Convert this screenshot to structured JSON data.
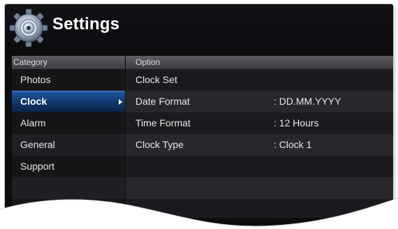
{
  "header": {
    "title": "Settings",
    "icon": "settings-gear-icon"
  },
  "category_pane": {
    "header": "Category",
    "items": [
      "Photos",
      "Clock",
      "Alarm",
      "General",
      "Support"
    ],
    "selected": "Clock"
  },
  "option_pane": {
    "header": "Option",
    "rows": [
      {
        "label": "Clock Set",
        "value": ""
      },
      {
        "label": "Date Format",
        "value": ": DD.MM.YYYY"
      },
      {
        "label": "Time Format",
        "value": ": 12 Hours"
      },
      {
        "label": "Clock Type",
        "value": ": Clock 1"
      }
    ]
  },
  "colors": {
    "background": "#0c0d0f",
    "selection": "#1d5aa7",
    "header_bar": "#4a4b4f"
  }
}
